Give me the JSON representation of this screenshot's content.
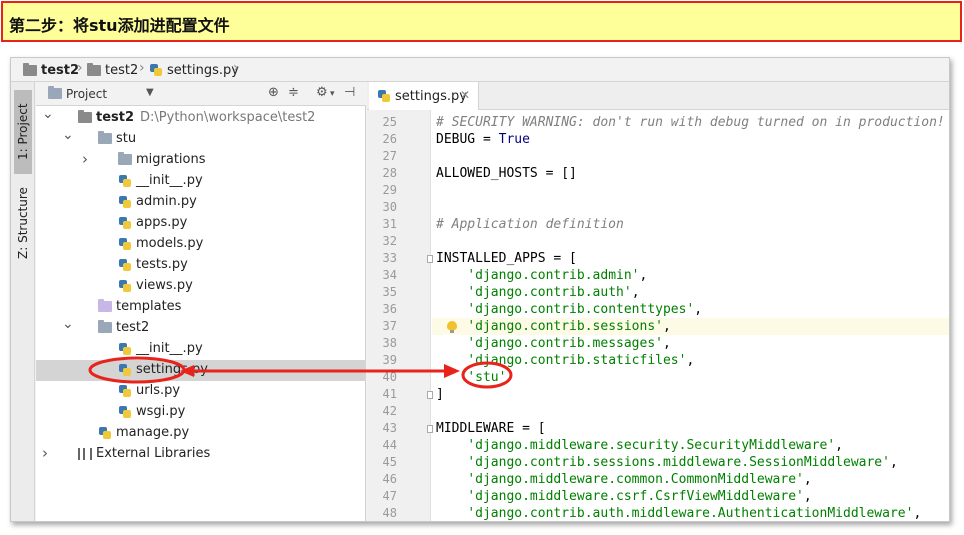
{
  "banner": {
    "text": "第二步：将stu添加进配置文件"
  },
  "breadcrumb": {
    "items": [
      "test2",
      "test2",
      "settings.py"
    ]
  },
  "toolstrip": {
    "project_tab": "1: Project",
    "structure_tab": "Z: Structure"
  },
  "project_panel": {
    "title": "Project",
    "tree": [
      {
        "label": "test2",
        "path": "D:\\Python\\workspace\\test2",
        "icon": "folder-icon",
        "arrow": "expanded"
      },
      {
        "label": "stu",
        "icon": "folder-icon",
        "arrow": "expanded"
      },
      {
        "label": "migrations",
        "icon": "folder-icon",
        "arrow": "collapsed"
      },
      {
        "label": "__init__.py",
        "icon": "python-file-icon"
      },
      {
        "label": "admin.py",
        "icon": "python-file-icon"
      },
      {
        "label": "apps.py",
        "icon": "python-file-icon"
      },
      {
        "label": "models.py",
        "icon": "python-file-icon"
      },
      {
        "label": "tests.py",
        "icon": "python-file-icon"
      },
      {
        "label": "views.py",
        "icon": "python-file-icon"
      },
      {
        "label": "templates",
        "icon": "templates-folder-icon"
      },
      {
        "label": "test2",
        "icon": "folder-icon",
        "arrow": "expanded"
      },
      {
        "label": "__init__.py",
        "icon": "python-file-icon"
      },
      {
        "label": "settings.py",
        "icon": "python-file-icon",
        "selected": true
      },
      {
        "label": "urls.py",
        "icon": "python-file-icon"
      },
      {
        "label": "wsgi.py",
        "icon": "python-file-icon"
      },
      {
        "label": "manage.py",
        "icon": "python-file-icon"
      },
      {
        "label": "External Libraries",
        "icon": "library-icon",
        "arrow": "collapsed"
      }
    ]
  },
  "editor": {
    "tab_label": "settings.py",
    "lines": [
      {
        "num": "25",
        "text": "# SECURITY WARNING: don't run with debug turned on in production!",
        "kind": "comment"
      },
      {
        "num": "26",
        "text": "DEBUG = True",
        "kind": "debug"
      },
      {
        "num": "27",
        "text": "",
        "kind": "plain"
      },
      {
        "num": "28",
        "text": "ALLOWED_HOSTS = []",
        "kind": "plain"
      },
      {
        "num": "29",
        "text": "",
        "kind": "plain"
      },
      {
        "num": "30",
        "text": "",
        "kind": "plain"
      },
      {
        "num": "31",
        "text": "# Application definition",
        "kind": "comment"
      },
      {
        "num": "32",
        "text": "",
        "kind": "plain"
      },
      {
        "num": "33",
        "text": "INSTALLED_APPS = [",
        "kind": "plain"
      },
      {
        "num": "34",
        "text": "    'django.contrib.admin',",
        "kind": "string"
      },
      {
        "num": "35",
        "text": "    'django.contrib.auth',",
        "kind": "string"
      },
      {
        "num": "36",
        "text": "    'django.contrib.contenttypes',",
        "kind": "string"
      },
      {
        "num": "37",
        "text": "    'django.contrib.sessions',",
        "kind": "string",
        "highlight": true
      },
      {
        "num": "38",
        "text": "    'django.contrib.messages',",
        "kind": "string"
      },
      {
        "num": "39",
        "text": "    'django.contrib.staticfiles',",
        "kind": "string"
      },
      {
        "num": "40",
        "text": "    'stu'",
        "kind": "string"
      },
      {
        "num": "41",
        "text": "]",
        "kind": "plain"
      },
      {
        "num": "42",
        "text": "",
        "kind": "plain"
      },
      {
        "num": "43",
        "text": "MIDDLEWARE = [",
        "kind": "plain"
      },
      {
        "num": "44",
        "text": "    'django.middleware.security.SecurityMiddleware',",
        "kind": "string"
      },
      {
        "num": "45",
        "text": "    'django.contrib.sessions.middleware.SessionMiddleware',",
        "kind": "string"
      },
      {
        "num": "46",
        "text": "    'django.middleware.common.CommonMiddleware',",
        "kind": "string"
      },
      {
        "num": "47",
        "text": "    'django.middleware.csrf.CsrfViewMiddleware',",
        "kind": "string"
      },
      {
        "num": "48",
        "text": "    'django.contrib.auth.middleware.AuthenticationMiddleware',",
        "kind": "string"
      }
    ]
  },
  "colors": {
    "annotation_red": "#e8231c",
    "banner_bg": "#ffff99",
    "string_green": "#008000",
    "keyword_navy": "#000080"
  }
}
